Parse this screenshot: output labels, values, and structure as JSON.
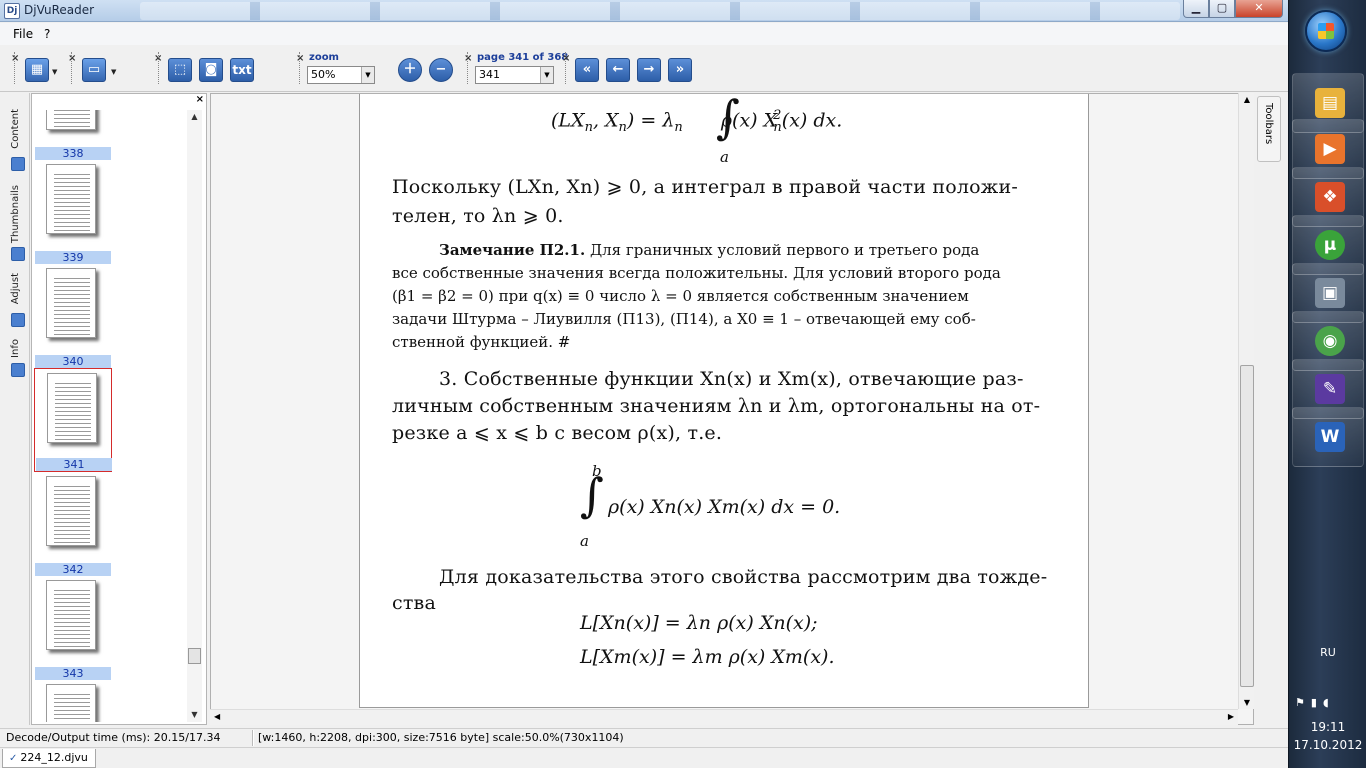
{
  "window": {
    "title": "DjVuReader",
    "app_icon": "Dj",
    "min": "▁",
    "max": "▢",
    "close": "✕"
  },
  "menu": {
    "file": "File",
    "help": "?"
  },
  "toolbar": {
    "zoom_label": "zoom",
    "zoom_value": "50%",
    "page_label": "page 341 of 368",
    "page_value": "341",
    "text_button": "txt",
    "close_glyph": "×"
  },
  "side_tabs": [
    {
      "label": "Content"
    },
    {
      "label": "Thumbnails"
    },
    {
      "label": "Adjust"
    },
    {
      "label": "Info"
    }
  ],
  "thumbnails": [
    {
      "number": "338"
    },
    {
      "number": "339"
    },
    {
      "number": "340"
    },
    {
      "number": "341",
      "selected": true
    },
    {
      "number": "342"
    },
    {
      "number": "343"
    },
    {
      "number": ""
    }
  ],
  "document": {
    "eq1_left": "(LX",
    "eq1_sub": "n",
    "eq1_mid": ", X",
    "eq1_right": ") = λ",
    "eq1_tail": "ρ(x) X",
    "eq1_sup": "2",
    "eq1_end": "(x) dx.",
    "eq1_lower": "a",
    "para1_line1": "Поскольку (LXn, Xn) ⩾ 0, а интеграл в правой части положи-",
    "para1_line2": "телен, то λn ⩾ 0.",
    "remark_title": "Замечание П2.1.",
    "remark_line1": "Для граничных условий первого и третьего рода",
    "remark_line2": "все собственные значения всегда положительны.  Для условий второго рода",
    "remark_line3": "(β1 = β2 = 0) при q(x) ≡ 0 число λ = 0 является собственным значением",
    "remark_line4": "задачи Штурма – Лиувилля (П13), (П14), а X0 ≡ 1 – отвечающей ему соб-",
    "remark_line5": "ственной функцией. #",
    "para3_line1": "3. Собственные функции Xn(x) и Xm(x), отвечающие раз-",
    "para3_line2": "личным собственным значениям λn и λm, ортогональны на от-",
    "para3_line3": "резке a ⩽ x ⩽ b с весом ρ(x), т.е.",
    "eq2_upper": "b",
    "eq2_lower": "a",
    "eq2_body": "ρ(x) Xn(x) Xm(x) dx = 0.",
    "para4_line1": "Для доказательства этого свойства рассмотрим два тождe-",
    "para4_line2": "ства",
    "eq3": "L[Xn(x)] = λn ρ(x) Xn(x);",
    "eq4": "L[Xm(x)] = λm ρ(x) Xm(x)."
  },
  "toolbars_tab": "Toolbars",
  "status": {
    "decode": "Decode/Output time (ms): 20.15/17.34",
    "info": "[w:1460, h:2208, dpi:300, size:7516 byte] scale:50.0%(730x1104)"
  },
  "doc_tab": "224_12.djvu",
  "taskbar": {
    "apps": [
      {
        "icon": "folder-icon",
        "color": "#e8b23c",
        "glyph": "▤"
      },
      {
        "icon": "media-player-icon",
        "color": "#e9742c",
        "glyph": "▶"
      },
      {
        "icon": "office-icon",
        "color": "#d94f2a",
        "glyph": "❖"
      },
      {
        "icon": "utorrent-icon",
        "color": "#3aa33a",
        "glyph": "µ"
      },
      {
        "icon": "computer-icon",
        "color": "#7a8a9c",
        "glyph": "▣"
      },
      {
        "icon": "chrome-icon",
        "color": "#4aa34a",
        "glyph": "◉"
      },
      {
        "icon": "djvu-reader-icon",
        "color": "#5b3aa0",
        "glyph": "✎"
      },
      {
        "icon": "word-icon",
        "color": "#2a63b9",
        "glyph": "W"
      }
    ],
    "lang": "RU",
    "time": "19:11",
    "date": "17.10.2012"
  }
}
